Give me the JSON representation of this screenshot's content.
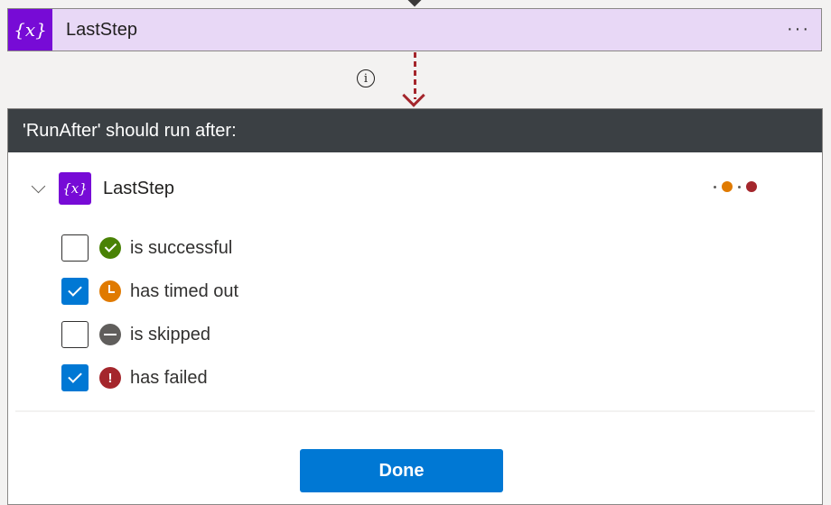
{
  "action_card": {
    "icon": "variable-icon",
    "icon_glyph": "{x}",
    "title": "LastStep",
    "more_label": "···",
    "color": "#770bd6",
    "background": "#e8d8f6"
  },
  "info_icon_glyph": "i",
  "connector_color": "#a4262c",
  "panel": {
    "header": "'RunAfter' should run after:",
    "step": {
      "icon_glyph": "{x}",
      "title": "LastStep",
      "status_colors": [
        "#e07a00",
        "#a4262c"
      ]
    },
    "options": [
      {
        "label": "is successful",
        "checked": false,
        "status": "success",
        "color": "#498205"
      },
      {
        "label": "has timed out",
        "checked": true,
        "status": "timed-out",
        "color": "#e07a00"
      },
      {
        "label": "is skipped",
        "checked": false,
        "status": "skipped",
        "color": "#605e5c"
      },
      {
        "label": "has failed",
        "checked": true,
        "status": "failed",
        "color": "#a4262c"
      }
    ],
    "done_label": "Done"
  }
}
